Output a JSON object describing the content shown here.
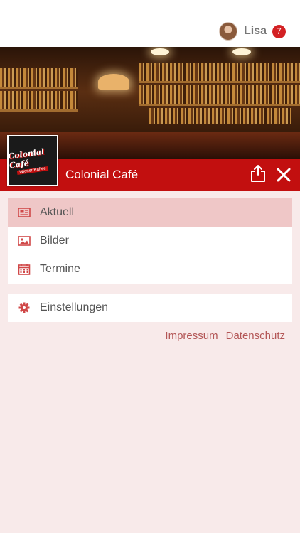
{
  "user": {
    "name": "Lisa",
    "notifications": "7"
  },
  "header": {
    "title": "Colonial Café",
    "logo_text": "Colonial Café",
    "logo_subtext": "Wiener Kaffee"
  },
  "menu": [
    {
      "label": "Aktuell",
      "icon": "newspaper-icon",
      "active": true
    },
    {
      "label": "Bilder",
      "icon": "image-icon",
      "active": false
    },
    {
      "label": "Termine",
      "icon": "calendar-icon",
      "active": false
    }
  ],
  "settings": {
    "label": "Einstellungen",
    "icon": "gear-icon"
  },
  "footer_links": {
    "impressum": "Impressum",
    "datenschutz": "Datenschutz"
  },
  "colors": {
    "accent": "#c20f0f",
    "background": "#f8eaea",
    "active_row": "#efc7c7",
    "icon": "#d04848",
    "link": "#b35656"
  }
}
